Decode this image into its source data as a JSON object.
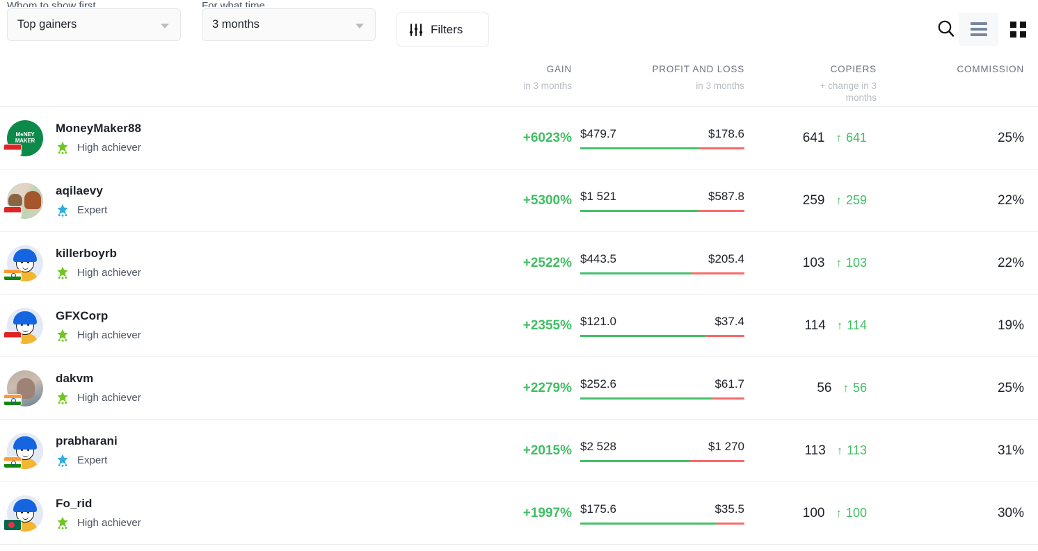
{
  "toolbar": {
    "sort": {
      "label": "Whom to show first",
      "value": "Top gainers"
    },
    "time": {
      "label": "For what time",
      "value": "3 months"
    },
    "filters_label": "Filters",
    "search_icon": "search-icon",
    "list_view_icon": "list-view-icon",
    "grid_view_icon": "grid-view-icon",
    "active_view": "list"
  },
  "table": {
    "headers": [
      {
        "title": "",
        "sub": ""
      },
      {
        "title": "GAIN",
        "sub": "in 3 months"
      },
      {
        "title": "PROFIT AND LOSS",
        "sub": "in 3 months"
      },
      {
        "title": "COPIERS",
        "sub": "+ change in 3 months"
      },
      {
        "title": "COMMISSION",
        "sub": ""
      }
    ],
    "rows": [
      {
        "name": "MoneyMaker88",
        "badge": "High achiever",
        "badge_type": "high-achiever",
        "avatar": "money-maker-logo",
        "flag": "id",
        "gain": "+6023%",
        "profit": "$479.7",
        "loss": "$178.6",
        "profit_pct": 72.9,
        "copiers": "641",
        "copiers_change": "641",
        "commission": "25%"
      },
      {
        "name": "aqilaevy",
        "badge": "Expert",
        "badge_type": "expert",
        "avatar": "bull-bear-photo",
        "flag": "id",
        "gain": "+5300%",
        "profit": "$1 521",
        "loss": "$587.8",
        "profit_pct": 72.1,
        "copiers": "259",
        "copiers_change": "259",
        "commission": "22%"
      },
      {
        "name": "killerboyrb",
        "badge": "High achiever",
        "badge_type": "high-achiever",
        "avatar": "cartoon-boy",
        "flag": "in",
        "gain": "+2522%",
        "profit": "$443.5",
        "loss": "$205.4",
        "profit_pct": 68.3,
        "copiers": "103",
        "copiers_change": "103",
        "commission": "22%"
      },
      {
        "name": "GFXCorp",
        "badge": "High achiever",
        "badge_type": "high-achiever",
        "avatar": "cartoon-boy",
        "flag": "id",
        "gain": "+2355%",
        "profit": "$121.0",
        "loss": "$37.4",
        "profit_pct": 76.4,
        "copiers": "114",
        "copiers_change": "114",
        "commission": "19%"
      },
      {
        "name": "dakvm",
        "badge": "High achiever",
        "badge_type": "high-achiever",
        "avatar": "woman-photo",
        "flag": "in",
        "gain": "+2279%",
        "profit": "$252.6",
        "loss": "$61.7",
        "profit_pct": 80.4,
        "copiers": "56",
        "copiers_change": "56",
        "commission": "25%"
      },
      {
        "name": "prabharani",
        "badge": "Expert",
        "badge_type": "expert",
        "avatar": "cartoon-boy",
        "flag": "in",
        "gain": "+2015%",
        "profit": "$2 528",
        "loss": "$1 270",
        "profit_pct": 66.6,
        "copiers": "113",
        "copiers_change": "113",
        "commission": "31%"
      },
      {
        "name": "Fo_rid",
        "badge": "High achiever",
        "badge_type": "high-achiever",
        "avatar": "cartoon-boy",
        "flag": "bd",
        "gain": "+1997%",
        "profit": "$175.6",
        "loss": "$35.5",
        "profit_pct": 83.2,
        "copiers": "100",
        "copiers_change": "100",
        "commission": "30%"
      }
    ]
  },
  "colors": {
    "gain_green": "#3fbf62",
    "bar_green": "#45bf6a",
    "bar_red": "#f96a6a",
    "muted": "#b7bcc3"
  },
  "icons": {
    "arrow_up": "↑"
  }
}
